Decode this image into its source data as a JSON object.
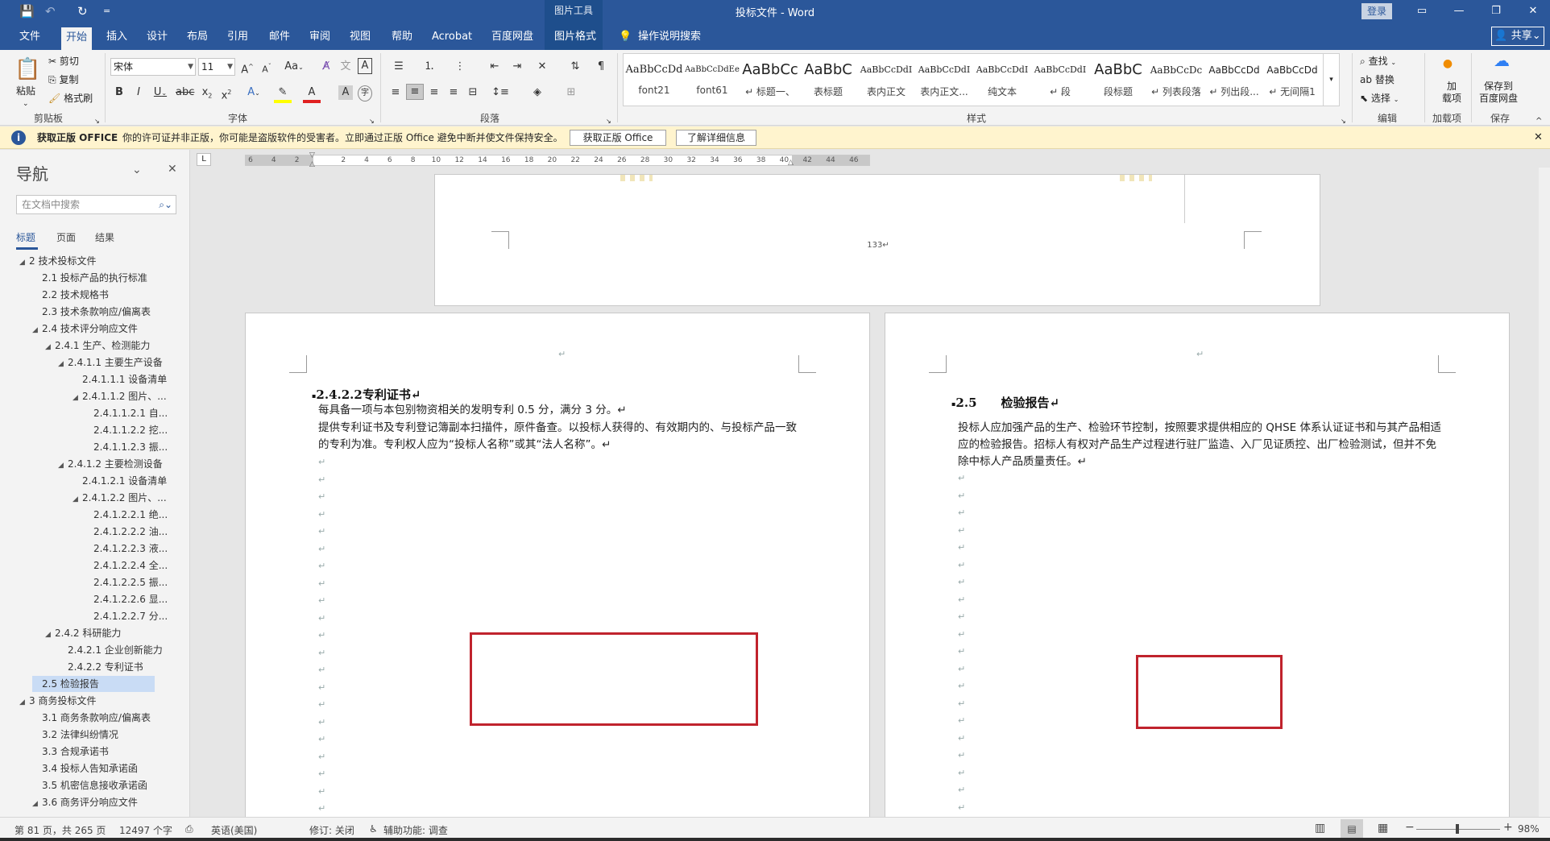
{
  "titlebar": {
    "title": "投标文件  -  Word",
    "picture_tools": "图片工具",
    "login": "登录",
    "qat_save": "💾",
    "qat_undo": "↶",
    "qat_redo": "↻",
    "qat_more": "="
  },
  "tabs": [
    "文件",
    "开始",
    "插入",
    "设计",
    "布局",
    "引用",
    "邮件",
    "审阅",
    "视图",
    "帮助",
    "Acrobat",
    "百度网盘",
    "图片格式"
  ],
  "tell_me": "操作说明搜索",
  "share": "共享",
  "ribbon": {
    "clipboard": {
      "paste": "粘贴",
      "cut": "剪切",
      "copy": "复制",
      "format_painter": "格式刷",
      "label": "剪贴板"
    },
    "font": {
      "name": "宋体",
      "size": "11",
      "label": "字体"
    },
    "paragraph": {
      "label": "段落"
    },
    "styles": {
      "label": "样式",
      "items": [
        {
          "preview": "AaBbCcDd",
          "name": "font21"
        },
        {
          "preview": "AaBbCcDdEe",
          "name": "font61"
        },
        {
          "preview": "AaBbCc",
          "name": "↵ 标题一、"
        },
        {
          "preview": "AaBbC",
          "name": "表标题"
        },
        {
          "preview": "AaBbCcDdI",
          "name": "表内正文"
        },
        {
          "preview": "AaBbCcDdI",
          "name": "表内正文..."
        },
        {
          "preview": "AaBbCcDdI",
          "name": "纯文本"
        },
        {
          "preview": "AaBbCcDdI",
          "name": "↵ 段"
        },
        {
          "preview": "AaBbC",
          "name": "段标题"
        },
        {
          "preview": "AaBbCcDc",
          "name": "↵ 列表段落"
        },
        {
          "preview": "AaBbCcDd",
          "name": "↵ 列出段..."
        },
        {
          "preview": "AaBbCcDd",
          "name": "↵ 无间隔1"
        }
      ]
    },
    "editing": {
      "find": "查找",
      "replace": "替换",
      "select": "选择",
      "label": "编辑"
    },
    "addins": {
      "button": "加载项",
      "line1": "加",
      "line2": "载项",
      "label": "加载项"
    },
    "save": {
      "line1": "保存到",
      "line2": "百度网盘",
      "label": "保存"
    }
  },
  "message_bar": {
    "title": "获取正版 OFFICE",
    "text": "你的许可证并非正版，你可能是盗版软件的受害者。立即通过正版 Office 避免中断并使文件保持安全。",
    "btn_get": "获取正版 Office",
    "btn_learn": "了解详细信息"
  },
  "nav": {
    "title": "导航",
    "search_placeholder": "在文档中搜索",
    "tabs": [
      "标题",
      "页面",
      "结果"
    ],
    "tree": [
      {
        "level": 1,
        "arrow": "◢",
        "text": "2 技术投标文件"
      },
      {
        "level": 2,
        "arrow": "",
        "text": "2.1 投标产品的执行标准"
      },
      {
        "level": 2,
        "arrow": "",
        "text": "2.2 技术规格书"
      },
      {
        "level": 2,
        "arrow": "",
        "text": "2.3 技术条款响应/偏离表"
      },
      {
        "level": 2,
        "arrow": "◢",
        "text": "2.4 技术评分响应文件"
      },
      {
        "level": 3,
        "arrow": "◢",
        "text": "2.4.1 生产、检测能力"
      },
      {
        "level": 4,
        "arrow": "◢",
        "text": "2.4.1.1 主要生产设备"
      },
      {
        "level": 5,
        "arrow": "",
        "text": "2.4.1.1.1 设备清单"
      },
      {
        "level": 5,
        "arrow": "◢",
        "text": "2.4.1.1.2 图片、..."
      },
      {
        "level": 6,
        "arrow": "",
        "text": "2.4.1.1.2.1 自..."
      },
      {
        "level": 6,
        "arrow": "",
        "text": "2.4.1.1.2.2 挖..."
      },
      {
        "level": 6,
        "arrow": "",
        "text": "2.4.1.1.2.3 振..."
      },
      {
        "level": 4,
        "arrow": "◢",
        "text": "2.4.1.2 主要检测设备"
      },
      {
        "level": 5,
        "arrow": "",
        "text": "2.4.1.2.1 设备清单"
      },
      {
        "level": 5,
        "arrow": "◢",
        "text": "2.4.1.2.2 图片、..."
      },
      {
        "level": 6,
        "arrow": "",
        "text": "2.4.1.2.2.1 绝..."
      },
      {
        "level": 6,
        "arrow": "",
        "text": "2.4.1.2.2.2 油..."
      },
      {
        "level": 6,
        "arrow": "",
        "text": "2.4.1.2.2.3 液..."
      },
      {
        "level": 6,
        "arrow": "",
        "text": "2.4.1.2.2.4 全..."
      },
      {
        "level": 6,
        "arrow": "",
        "text": "2.4.1.2.2.5 振..."
      },
      {
        "level": 6,
        "arrow": "",
        "text": "2.4.1.2.2.6 显..."
      },
      {
        "level": 6,
        "arrow": "",
        "text": "2.4.1.2.2.7 分..."
      },
      {
        "level": 3,
        "arrow": "◢",
        "text": "2.4.2 科研能力"
      },
      {
        "level": 4,
        "arrow": "",
        "text": "2.4.2.1 企业创新能力"
      },
      {
        "level": 4,
        "arrow": "",
        "text": "2.4.2.2 专利证书"
      },
      {
        "level": 2,
        "arrow": "",
        "text": "2.5 检验报告",
        "selected": true
      },
      {
        "level": 1,
        "arrow": "◢",
        "text": "3 商务投标文件"
      },
      {
        "level": 2,
        "arrow": "",
        "text": "3.1 商务条款响应/偏离表"
      },
      {
        "level": 2,
        "arrow": "",
        "text": "3.2 法律纠纷情况"
      },
      {
        "level": 2,
        "arrow": "",
        "text": "3.3 合规承诺书"
      },
      {
        "level": 2,
        "arrow": "",
        "text": "3.4 投标人告知承诺函"
      },
      {
        "level": 2,
        "arrow": "",
        "text": "3.5 机密信息接收承诺函"
      },
      {
        "level": 2,
        "arrow": "◢",
        "text": "3.6 商务评分响应文件"
      }
    ]
  },
  "ruler": {
    "tab": "L",
    "ticks": [
      "6",
      "4",
      "2",
      "",
      "2",
      "4",
      "6",
      "8",
      "10",
      "12",
      "14",
      "16",
      "18",
      "20",
      "22",
      "24",
      "26",
      "28",
      "30",
      "32",
      "34",
      "36",
      "38",
      "40",
      "42",
      "44",
      "46"
    ]
  },
  "document": {
    "page_number": "133↵",
    "left_page": {
      "top_mark": "↵",
      "heading": "2.4.2.2专利证书↵",
      "para1": "每具备一项与本包别物资相关的发明专利 0.5 分，满分 3 分。↵",
      "para2": "提供专利证书及专利登记簿副本扫描件，原件备查。以投标人获得的、有效期内的、与投标产品一致的专利为准。专利权人应为“投标人名称”或其“法人名称”。↵",
      "para_mark": "↵"
    },
    "right_page": {
      "top_mark": "↵",
      "heading_num": "2.5",
      "heading_text": "检验报告↵",
      "para1": "投标人应加强产品的生产、检验环节控制，按照要求提供相应的 QHSE 体系认证证书和与其产品相适应的检验报告。招标人有权对产品生产过程进行驻厂监造、入厂见证质控、出厂检验测试，但并不免除中标人产品质量责任。↵",
      "para_mark": "↵"
    }
  },
  "status": {
    "page": "第 81 页，共 265 页",
    "words": "12497 个字",
    "language": "英语(美国)",
    "track": "修订: 关闭",
    "accessibility": "辅助功能: 调查",
    "zoom": "98%",
    "zoom_minus": "−",
    "zoom_plus": "+"
  }
}
